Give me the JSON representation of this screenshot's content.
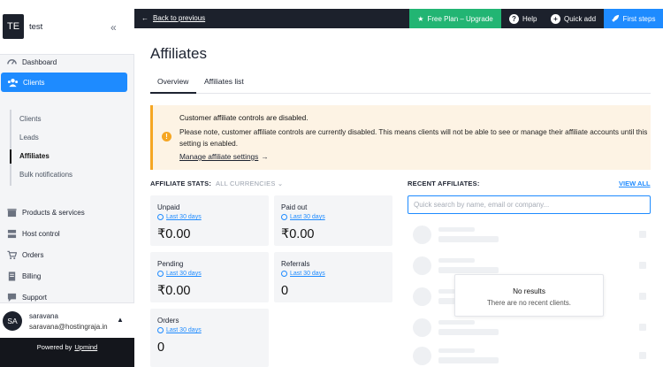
{
  "workspace": {
    "initials": "TE",
    "name": "test"
  },
  "colors": {
    "accent": "#1e8bff",
    "upgrade": "#22b573",
    "topbar": "#1c212c",
    "warning": "#f5a623"
  },
  "sidebar": {
    "items": [
      {
        "label": "Dashboard",
        "icon": "dashboard-icon"
      },
      {
        "label": "Clients",
        "icon": "users-icon",
        "active": true
      }
    ],
    "subitems": [
      {
        "label": "Clients"
      },
      {
        "label": "Leads"
      },
      {
        "label": "Affiliates",
        "active": true
      },
      {
        "label": "Bulk notifications"
      }
    ],
    "items2": [
      {
        "label": "Products & services",
        "icon": "box-icon"
      },
      {
        "label": "Host control",
        "icon": "server-icon"
      },
      {
        "label": "Orders",
        "icon": "cart-icon"
      },
      {
        "label": "Billing",
        "icon": "receipt-icon"
      },
      {
        "label": "Support",
        "icon": "chat-icon"
      }
    ]
  },
  "user": {
    "initials": "SA",
    "name": "saravana",
    "email": "saravana@hostingraja.in"
  },
  "footer": {
    "powered_prefix": "Powered by",
    "powered_brand": "Upmind"
  },
  "topbar": {
    "back_label": "Back to previous",
    "upgrade_label": "Free Plan – Upgrade",
    "help_label": "Help",
    "quick_add_label": "Quick add",
    "first_steps_label": "First steps"
  },
  "page": {
    "title": "Affiliates",
    "tabs": [
      {
        "label": "Overview",
        "active": true
      },
      {
        "label": "Affiliates list"
      }
    ]
  },
  "alert": {
    "title": "Customer affiliate controls are disabled.",
    "body": "Please note, customer affiliate controls are currently disabled. This means clients will not be able to see or manage their affiliate accounts until this setting is enabled.",
    "link": "Manage affiliate settings"
  },
  "stats": {
    "heading": "AFFILIATE STATS:",
    "currency_filter": "ALL CURRENCIES",
    "cards": [
      {
        "label": "Unpaid",
        "period": "Last 30 days",
        "value": "₹0.00"
      },
      {
        "label": "Paid out",
        "period": "Last 30 days",
        "value": "₹0.00"
      },
      {
        "label": "Pending",
        "period": "Last 30 days",
        "value": "₹0.00"
      },
      {
        "label": "Referrals",
        "period": "Last 30 days",
        "value": "0"
      },
      {
        "label": "Orders",
        "period": "Last 30 days",
        "value": "0"
      }
    ]
  },
  "recent": {
    "heading": "RECENT AFFILIATES:",
    "view_all": "VIEW ALL",
    "search_placeholder": "Quick search by name, email or company...",
    "empty_title": "No results",
    "empty_subtitle": "There are no recent clients."
  }
}
